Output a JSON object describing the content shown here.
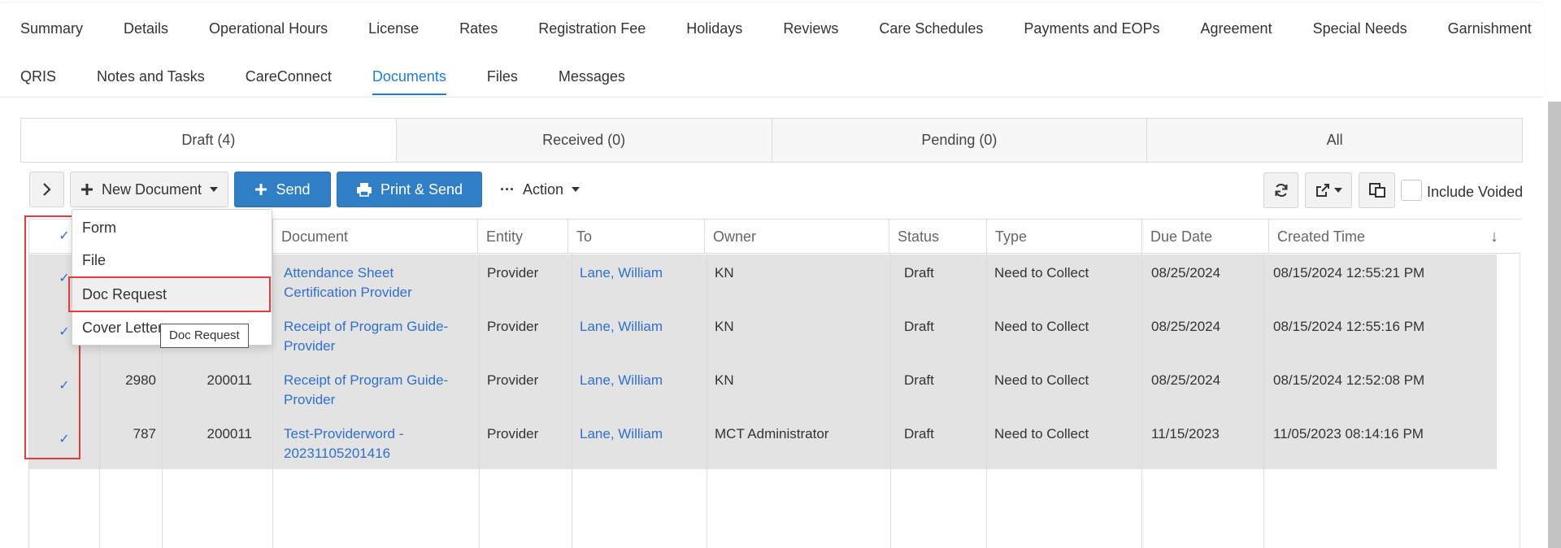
{
  "nav": {
    "row1": [
      "Summary",
      "Details",
      "Operational Hours",
      "License",
      "Rates",
      "Registration Fee",
      "Holidays",
      "Reviews",
      "Care Schedules",
      "Payments and EOPs",
      "Agreement",
      "Special Needs",
      "Garnishment"
    ],
    "row2": [
      "QRIS",
      "Notes and Tasks",
      "CareConnect",
      "Documents",
      "Files",
      "Messages"
    ],
    "active": "Documents"
  },
  "status_tabs": [
    "Draft (4)",
    "Received (0)",
    "Pending (0)",
    "All"
  ],
  "toolbar": {
    "new_document": "New Document",
    "send": "Send",
    "print_send": "Print & Send",
    "action": "Action",
    "include_voided": "Include Voided"
  },
  "grid": {
    "headers": [
      "Document",
      "Entity",
      "To",
      "Owner",
      "Status",
      "Type",
      "Due Date",
      "Created Time"
    ],
    "rows": [
      {
        "id": "",
        "code": "",
        "doc1": "Attendance Sheet",
        "doc2": "Certification Provider",
        "entity": "Provider",
        "to": "Lane, William",
        "owner": "KN",
        "status": "Draft",
        "type": "Need to Collect",
        "due": "08/25/2024",
        "created": "08/15/2024 12:55:21 PM"
      },
      {
        "id": "",
        "code": "",
        "doc1": "Receipt of Program Guide-",
        "doc2": "Provider",
        "entity": "Provider",
        "to": "Lane, William",
        "owner": "KN",
        "status": "Draft",
        "type": "Need to Collect",
        "due": "08/25/2024",
        "created": "08/15/2024 12:55:16 PM"
      },
      {
        "id": "2980",
        "code": "200011",
        "doc1": "Receipt of Program Guide-",
        "doc2": "Provider",
        "entity": "Provider",
        "to": "Lane, William",
        "owner": "KN",
        "status": "Draft",
        "type": "Need to Collect",
        "due": "08/25/2024",
        "created": "08/15/2024 12:52:08 PM"
      },
      {
        "id": "787",
        "code": "200011",
        "doc1": "Test-Providerword -",
        "doc2": "20231105201416",
        "entity": "Provider",
        "to": "Lane, William",
        "owner": "MCT Administrator",
        "status": "Draft",
        "type": "Need to Collect",
        "due": "11/15/2023",
        "created": "11/05/2023 08:14:16 PM"
      }
    ]
  },
  "dropdown": {
    "items": [
      "Form",
      "File",
      "Doc Request",
      "Cover Letter"
    ],
    "tooltip": "Doc Request"
  },
  "icons": {
    "expand": "chevron-right-icon",
    "plus": "plus-icon",
    "print": "printer-icon",
    "ellipsis": "ellipsis-icon",
    "refresh": "refresh-icon",
    "export": "export-icon",
    "columns": "columns-icon",
    "sort": "arrow-down-icon",
    "check": "checkmark-icon"
  },
  "colors": {
    "accent": "#1e7dd6",
    "button_blue": "#2f7ec6",
    "link": "#2e6fd1",
    "highlight": "#e53b3b",
    "row_bg": "#e3e3e3"
  }
}
